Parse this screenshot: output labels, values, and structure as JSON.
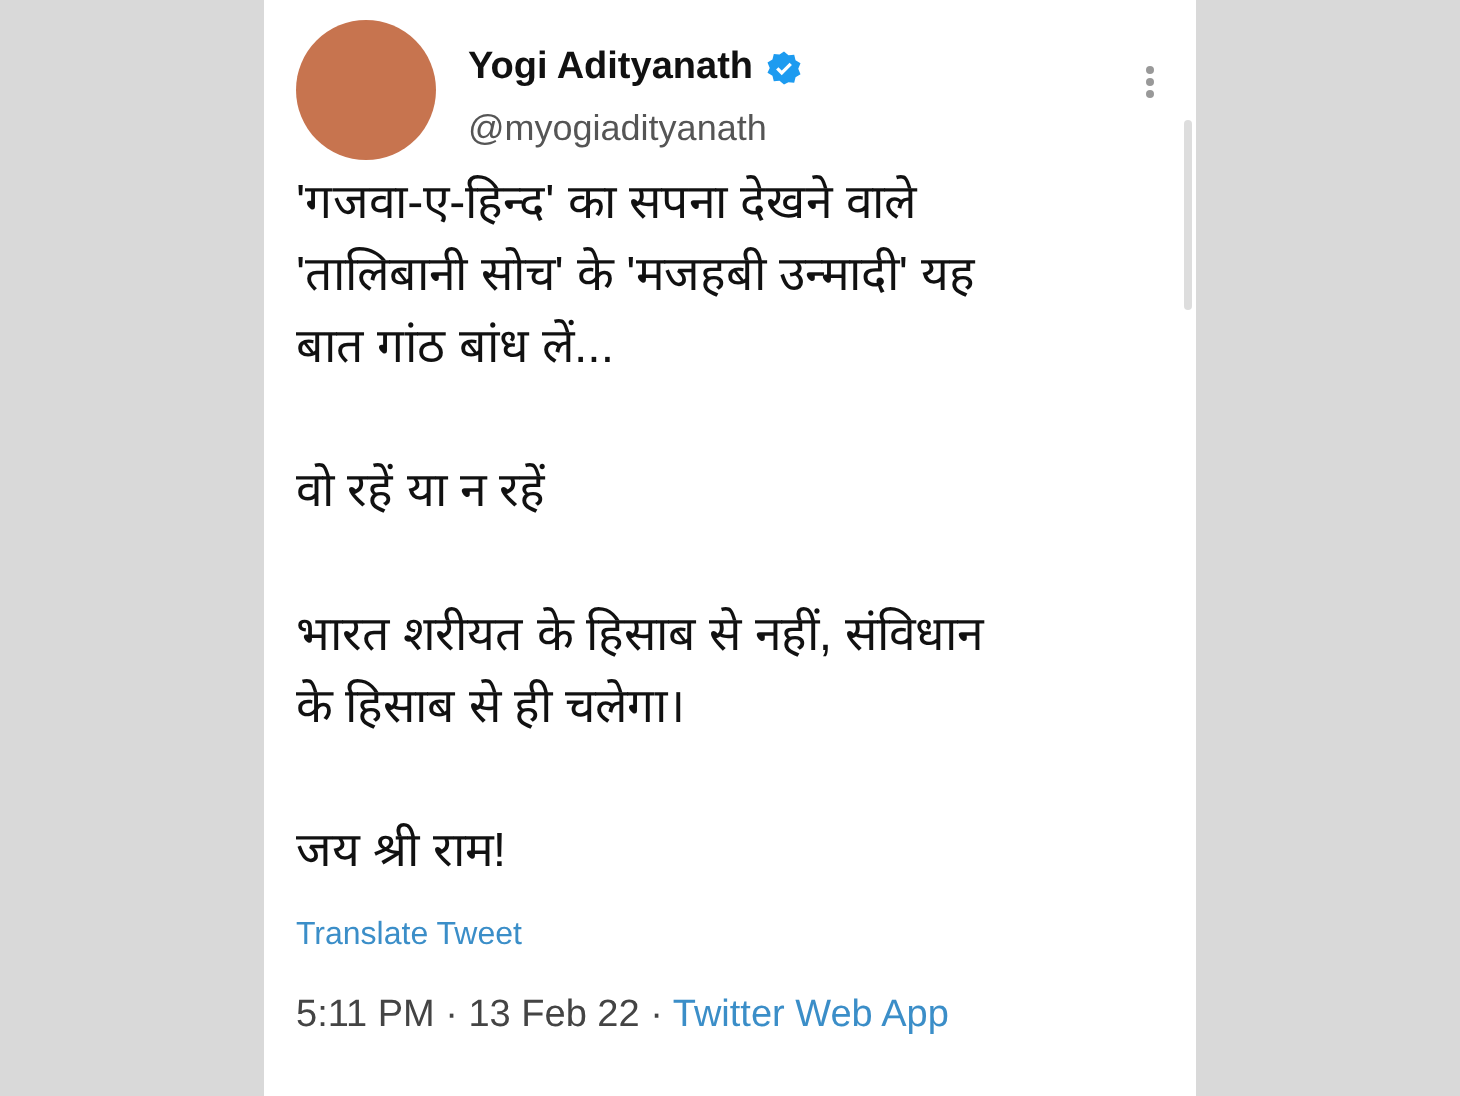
{
  "tweet": {
    "name": "Yogi Adityanath",
    "verified": true,
    "handle": "@myogiadityanath",
    "paragraphs": [
      "'गजवा-ए-हिन्द' का सपना देखने वाले\n'तालिबानी सोच' के 'मजहबी उन्मादी' यह\nबात गांठ बांध लें...",
      "वो रहें या न रहें",
      "भारत शरीयत के हिसाब से नहीं, संविधान\nके हिसाब से ही चलेगा।",
      "जय श्री राम!"
    ],
    "translate": "Translate Tweet",
    "timestamp": "5:11 PM · 13 Feb 22 ·",
    "source": "Twitter Web App"
  }
}
